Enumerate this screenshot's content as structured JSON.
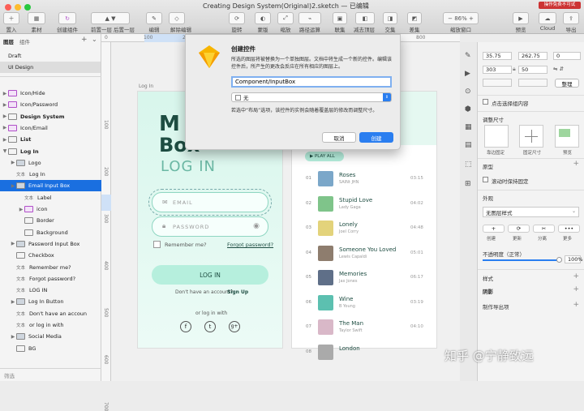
{
  "window": {
    "title": "Creating Design System(Original)2.sketch — 已编辑"
  },
  "toolbar": {
    "insert": "置入",
    "material": "素材",
    "create_symbol": "创建组件",
    "forward": "前置一层",
    "backward": "后置一层",
    "edit": "编辑",
    "transform": "旋转",
    "flatten": "解除编辑",
    "rotate": "旋转",
    "mask": "蒙版",
    "scale": "缩放",
    "path_op": "路径运算",
    "union": "联集",
    "subtract": "减去顶层",
    "intersect": "交集",
    "difference": "差集",
    "zoom": "86%",
    "zoom_label": "缩放窗口",
    "preview": "预览",
    "cloud": "Cloud",
    "export": "导出",
    "badge": "操作免费不可试"
  },
  "layers": {
    "tab_layers": "图层",
    "tab_components": "组件",
    "pages": [
      "Draft",
      "UI Design"
    ],
    "items": [
      {
        "label": "Icon/Hide",
        "icon": "sym",
        "indent": 0
      },
      {
        "label": "Icon/Password",
        "icon": "sym",
        "indent": 0
      },
      {
        "label": "Design System",
        "icon": "art",
        "indent": 0
      },
      {
        "label": "Icon/Email",
        "icon": "sym",
        "indent": 0
      },
      {
        "label": "List",
        "icon": "art",
        "indent": 0
      },
      {
        "label": "Log In",
        "icon": "art",
        "indent": 0,
        "open": true
      },
      {
        "label": "Logo",
        "icon": "grp",
        "indent": 1
      },
      {
        "label": "Log In",
        "icon": "txt",
        "indent": 1
      },
      {
        "label": "Email Input Box",
        "icon": "grp",
        "indent": 1,
        "selected": true
      },
      {
        "label": "Label",
        "icon": "txt",
        "indent": 2
      },
      {
        "label": "icon",
        "icon": "sym",
        "indent": 2
      },
      {
        "label": "Border",
        "icon": "shape",
        "indent": 2
      },
      {
        "label": "Background",
        "icon": "shape",
        "indent": 2
      },
      {
        "label": "Password Input Box",
        "icon": "grp",
        "indent": 1
      },
      {
        "label": "Checkbox",
        "icon": "shape",
        "indent": 1
      },
      {
        "label": "Remember me?",
        "icon": "txt",
        "indent": 1
      },
      {
        "label": "Forgot password?",
        "icon": "txt",
        "indent": 1
      },
      {
        "label": "LOG IN",
        "icon": "txt",
        "indent": 1
      },
      {
        "label": "Log In Button",
        "icon": "grp",
        "indent": 1
      },
      {
        "label": "Don't have an accoun",
        "icon": "txt",
        "indent": 1
      },
      {
        "label": "or log in with",
        "icon": "txt",
        "indent": 1
      },
      {
        "label": "Social Media",
        "icon": "grp",
        "indent": 1
      },
      {
        "label": "BG",
        "icon": "shape",
        "indent": 1
      }
    ],
    "filter": "筛选"
  },
  "rulers": {
    "top": [
      "0",
      "100",
      "200",
      "300",
      "400",
      "500",
      "600",
      "700",
      "800"
    ],
    "left": [
      "100",
      "200",
      "300",
      "400",
      "500",
      "600",
      "700"
    ]
  },
  "dialog": {
    "title": "创建控件",
    "desc": "所选的图层将被替换为一个单独图层。文档中将生成一个新的控件。编辑该控件后，所产生的更改会反应在所有相应的图层上。",
    "name_value": "Component/InputBox",
    "select_value": "无",
    "note": "若选中“布局”选项，该控件的实例会随着覆盖层的修改而调整尺寸。",
    "cancel": "取消",
    "create": "创建"
  },
  "artboard_login": {
    "label": "Log In",
    "logo1": "M",
    "logo2": "Box",
    "title": "LOG IN",
    "email": "EMAIL",
    "password": "PASSWORD",
    "remember": "Remember me?",
    "forgot": "Forgot password?",
    "button": "LOG IN",
    "no_account": "Don't have an account?",
    "signup": "Sign Up",
    "or": "or log in with",
    "social": [
      "f",
      "t",
      "g+"
    ]
  },
  "artboard_list": {
    "play_all": "PLAY ALL",
    "songs": [
      {
        "n": "01",
        "title": "Roses",
        "artist": "SAINt JHN",
        "time": "03:15",
        "color": "#7ba7c9"
      },
      {
        "n": "02",
        "title": "Stupid Love",
        "artist": "Lady Gaga",
        "time": "04:02",
        "color": "#7fc48a"
      },
      {
        "n": "03",
        "title": "Lonely",
        "artist": "Joel Corry",
        "time": "04:48",
        "color": "#e3d37b"
      },
      {
        "n": "04",
        "title": "Someone You Loved",
        "artist": "Lewis Capaldi",
        "time": "05:01",
        "color": "#8e7d6e"
      },
      {
        "n": "05",
        "title": "Memories",
        "artist": "Jax Jones",
        "time": "06:17",
        "color": "#5f6f88"
      },
      {
        "n": "06",
        "title": "Wine",
        "artist": "B Young",
        "time": "03:19",
        "color": "#5cc0b0"
      },
      {
        "n": "07",
        "title": "The Man",
        "artist": "Taylor Swift",
        "time": "04:10",
        "color": "#d9b8c8"
      },
      {
        "n": "08",
        "title": "London",
        "artist": "",
        "time": "",
        "color": "#aaa"
      }
    ]
  },
  "inspector": {
    "x": "35.75",
    "y": "262.75",
    "r": "0",
    "w": "303",
    "h": "50",
    "tidy": "整理",
    "click_select": "点击选择组内容",
    "resize_label": "调整尺寸",
    "fix_edges": "靠边固定",
    "fix_size": "固定尺寸",
    "preview": "预览",
    "prototype": "原型",
    "scroll_fix": "滚动时保持固定",
    "appearance": "外观",
    "style": "无图层样式",
    "actions": [
      "创建",
      "更新",
      "分离",
      "更多"
    ],
    "opacity_label": "不透明度（正常）",
    "opacity_value": "100%",
    "style2": "样式",
    "shadow": "阴影",
    "export": "制作导出项"
  },
  "watermark": "知乎 @宁静致远",
  "colors": {
    "accent": "#1a6fe0",
    "mint": "#aee8d6",
    "dark_green": "#1e4d42"
  }
}
